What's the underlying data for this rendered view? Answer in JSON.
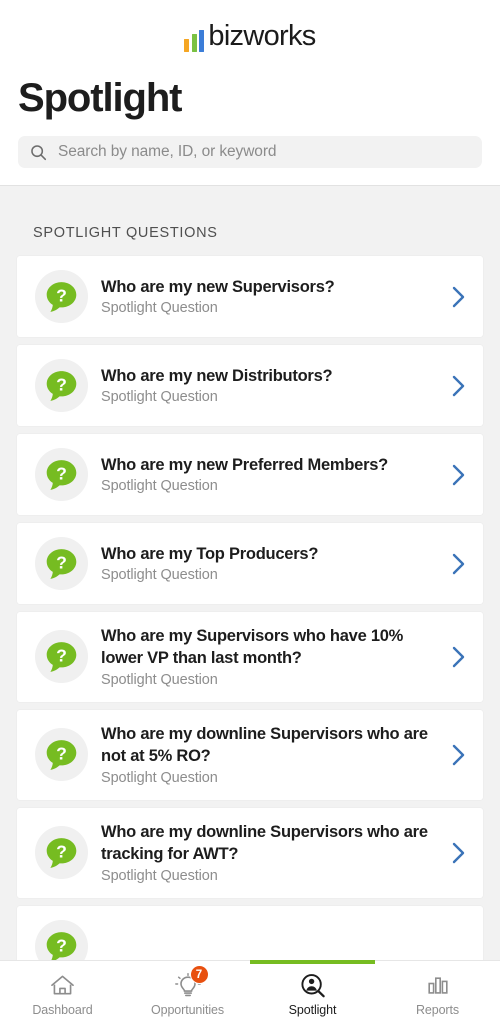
{
  "brand": {
    "name": "bizworks",
    "bar_colors": [
      "#f5a623",
      "#7ac143",
      "#3b7dd8"
    ]
  },
  "header": {
    "title": "Spotlight"
  },
  "search": {
    "placeholder": "Search by name, ID, or keyword",
    "value": "",
    "icon": "search-icon"
  },
  "main": {
    "section_label": "SPOTLIGHT QUESTIONS",
    "accent_green": "#76bc21",
    "chevron_color": "#3a73b8",
    "questions": [
      {
        "title": "Who are my new Supervisors?",
        "subtitle": "Spotlight Question",
        "icon": "question-bubble-icon"
      },
      {
        "title": "Who are my new Distributors?",
        "subtitle": "Spotlight Question",
        "icon": "question-bubble-icon"
      },
      {
        "title": "Who are my new Preferred Members?",
        "subtitle": "Spotlight Question",
        "icon": "question-bubble-icon"
      },
      {
        "title": "Who are my Top Producers?",
        "subtitle": "Spotlight Question",
        "icon": "question-bubble-icon"
      },
      {
        "title": "Who are my Supervisors who have 10% lower VP than last month?",
        "subtitle": "Spotlight Question",
        "icon": "question-bubble-icon"
      },
      {
        "title": "Who are my downline Supervisors who are not at 5% RO?",
        "subtitle": "Spotlight Question",
        "icon": "question-bubble-icon"
      },
      {
        "title": "Who are my downline Supervisors who are tracking for AWT?",
        "subtitle": "Spotlight Question",
        "icon": "question-bubble-icon"
      }
    ]
  },
  "tabbar": {
    "items": [
      {
        "label": "Dashboard",
        "icon": "home-icon",
        "active": false,
        "badge": ""
      },
      {
        "label": "Opportunities",
        "icon": "lightbulb-icon",
        "active": false,
        "badge": "7"
      },
      {
        "label": "Spotlight",
        "icon": "person-search-icon",
        "active": true,
        "badge": ""
      },
      {
        "label": "Reports",
        "icon": "bar-chart-icon",
        "active": false,
        "badge": ""
      }
    ],
    "badge_color": "#e8500f"
  }
}
